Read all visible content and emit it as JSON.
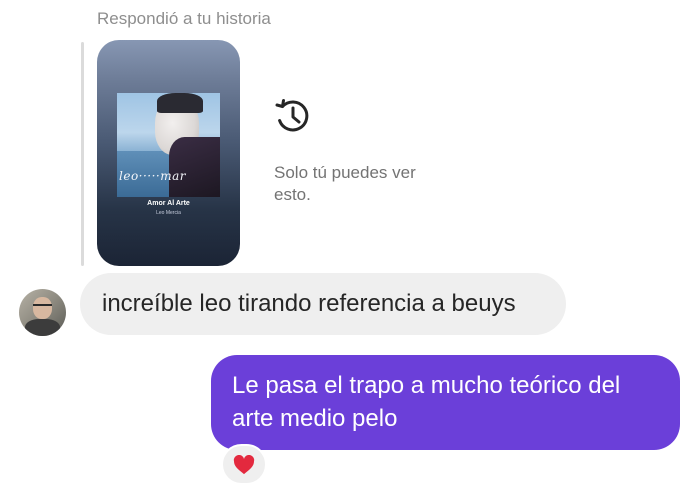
{
  "reply_context": {
    "header": "Respondió a tu historia",
    "story": {
      "album_script": "leo·····mar",
      "song_title": "Amor Al Arte",
      "song_artist": "Leo Mercia"
    },
    "history_icon": "history-icon",
    "private_note": "Solo tú puedes ver esto."
  },
  "messages": [
    {
      "direction": "received",
      "text": "increíble leo tirando referencia a beuys"
    },
    {
      "direction": "sent",
      "text": "Le pasa el trapo a mucho teórico del arte medio pelo",
      "color": "#6b3fd9",
      "reaction": "heart-icon"
    }
  ],
  "colors": {
    "sent_bubble": "#6b3fd9",
    "received_bubble": "#efefef",
    "reaction_heart": "#e3293e"
  }
}
